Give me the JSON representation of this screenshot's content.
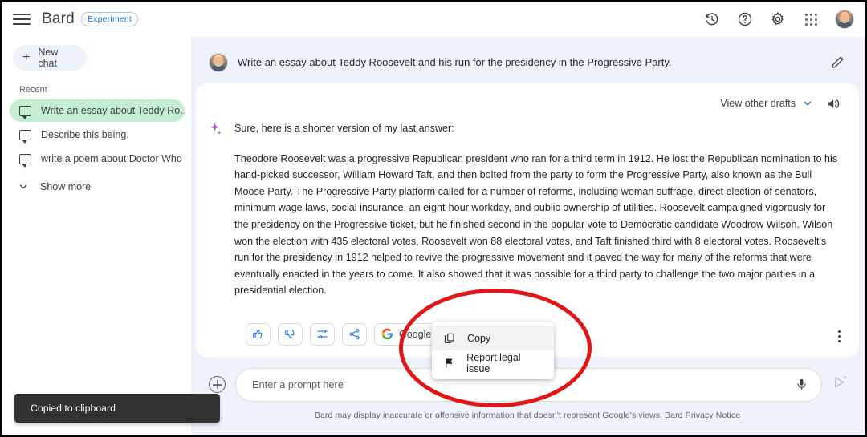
{
  "app": {
    "brand": "Bard",
    "experiment_badge": "Experiment"
  },
  "topbar": {
    "menu_icon": "hamburger-icon",
    "icons": [
      {
        "name": "history-icon",
        "label": "Activity"
      },
      {
        "name": "help-icon",
        "label": "Help"
      },
      {
        "name": "gear-icon",
        "label": "Settings"
      },
      {
        "name": "apps-grid-icon",
        "label": "Google apps"
      },
      {
        "name": "avatar",
        "label": "Account"
      }
    ]
  },
  "sidebar": {
    "new_chat_label": "New chat",
    "recent_label": "Recent",
    "items": [
      {
        "label": "Write an essay about Teddy Ro...",
        "active": true
      },
      {
        "label": "Describe this being.",
        "active": false
      },
      {
        "label": "write a poem about Doctor Who",
        "active": false
      }
    ],
    "show_more_label": "Show more"
  },
  "conversation": {
    "user_prompt": "Write an essay about Teddy Roosevelt and his run for the presidency in the Progressive Party.",
    "edit_icon": "pencil-icon",
    "drafts_label": "View other drafts",
    "speaker_icon": "speaker-icon",
    "answer_intro": "Sure, here is a shorter version of my last answer:",
    "answer_body": "Theodore Roosevelt was a progressive Republican president who ran for a third term in 1912. He lost the Republican nomination to his hand-picked successor, William Howard Taft, and then bolted from the party to form the Progressive Party, also known as the Bull Moose Party. The Progressive Party platform called for a number of reforms, including woman suffrage, direct election of senators, minimum wage laws, social insurance, an eight-hour workday, and public ownership of utilities. Roosevelt campaigned vigorously for the presidency on the Progressive ticket, but he finished second in the popular vote to Democratic candidate Woodrow Wilson. Wilson won the election with 435 electoral votes, Roosevelt won 88 electoral votes, and Taft finished third with 8 electoral votes. Roosevelt's run for the presidency in 1912 helped to revive the progressive movement and it paved the way for many of the reforms that were eventually enacted in the years to come. It also showed that it was possible for a third party to challenge the two major parties in a presidential election.",
    "actions": [
      {
        "name": "thumb-up-button",
        "label": ""
      },
      {
        "name": "thumb-down-button",
        "label": ""
      },
      {
        "name": "modify-response-button",
        "label": ""
      },
      {
        "name": "share-button",
        "label": ""
      },
      {
        "name": "google-it-button",
        "label": "Google it"
      }
    ],
    "google_it_label": "Google it",
    "more_options_icon": "kebab-menu-icon"
  },
  "context_menu": {
    "items": [
      {
        "label": "Copy",
        "icon": "copy-icon",
        "hovered": true
      },
      {
        "label": "Report legal issue",
        "icon": "flag-icon",
        "hovered": false
      }
    ]
  },
  "composer": {
    "add_icon": "plus-circle-icon",
    "placeholder": "Enter a prompt here",
    "mic_icon": "microphone-icon",
    "send_icon": "send-icon",
    "disclaimer": "Bard may display inaccurate or offensive information that doesn't represent Google's views.",
    "privacy_link": "Bard Privacy Notice"
  },
  "toast": {
    "message": "Copied to clipboard"
  },
  "annotation": {
    "shape": "red-ellipse-highlight",
    "color": "#e11717"
  }
}
